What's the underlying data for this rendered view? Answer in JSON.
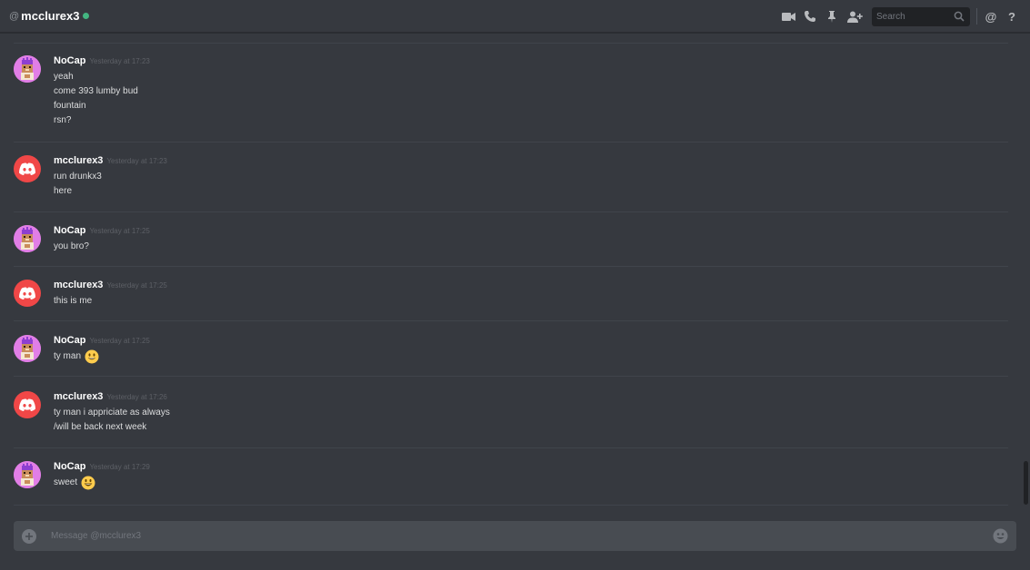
{
  "header": {
    "at_symbol": "@",
    "channel_name": "mcclurex3",
    "status_color": "#43b581",
    "icons": [
      "video-call-icon",
      "voice-call-icon",
      "pin-icon",
      "add-friend-icon"
    ],
    "search_placeholder": "Search",
    "mention_symbol": "@",
    "help_symbol": "?"
  },
  "messages": [
    {
      "author": "NoCap",
      "avatar": "nocap-avatar",
      "timestamp": "Yesterday at 17:23",
      "lines": [
        "yeah",
        "come 393 lumby bud",
        "fountain",
        "rsn?"
      ]
    },
    {
      "author": "mcclurex3",
      "avatar": "discord-default-avatar",
      "timestamp": "Yesterday at 17:23",
      "lines": [
        "run drunkx3",
        "here"
      ]
    },
    {
      "author": "NoCap",
      "avatar": "nocap-avatar",
      "timestamp": "Yesterday at 17:25",
      "lines": [
        "you bro?"
      ]
    },
    {
      "author": "mcclurex3",
      "avatar": "discord-default-avatar",
      "timestamp": "Yesterday at 17:25",
      "lines": [
        "this is me"
      ]
    },
    {
      "author": "NoCap",
      "avatar": "nocap-avatar",
      "timestamp": "Yesterday at 17:25",
      "lines": [
        "ty man"
      ],
      "emoji": "smiley-emoji"
    },
    {
      "author": "mcclurex3",
      "avatar": "discord-default-avatar",
      "timestamp": "Yesterday at 17:26",
      "lines": [
        "ty man i appriciate as always",
        "/will be back next week"
      ]
    },
    {
      "author": "NoCap",
      "avatar": "nocap-avatar",
      "timestamp": "Yesterday at 17:29",
      "lines": [
        "sweet"
      ],
      "emoji": "grin-emoji"
    }
  ],
  "composer": {
    "placeholder": "Message @mcclurex3",
    "icons": [
      "attach-plus-icon",
      "emoji-picker-icon"
    ]
  },
  "colors": {
    "background": "#36393f",
    "nocap_avatar": "#e17ee6",
    "discord_avatar": "#f04747",
    "composer": "#484c52"
  }
}
